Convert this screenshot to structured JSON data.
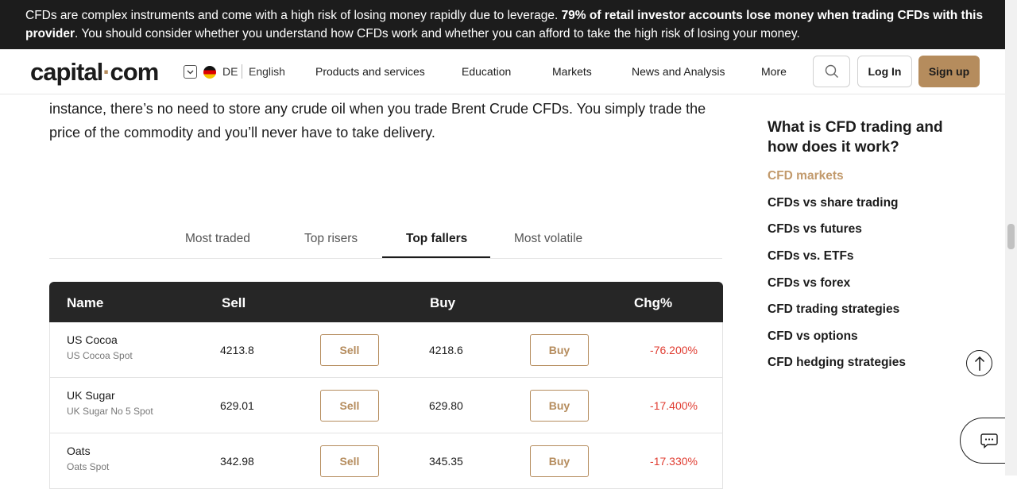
{
  "banner": {
    "text_before": "CFDs are complex instruments and come with a high risk of losing money rapidly due to leverage. ",
    "bold": "79% of retail investor accounts lose money when trading CFDs with this provider",
    "text_after": ". You should consider whether you understand how CFDs work and whether you can afford to take the high risk of losing your money."
  },
  "nav": {
    "logo_part1": "capital",
    "logo_dot": "·",
    "logo_part2": "com",
    "lang_code": "DE",
    "lang_name": "English",
    "items": [
      "Products and services",
      "Education",
      "Markets",
      "News and Analysis",
      "More"
    ],
    "login": "Log In",
    "signup": "Sign up"
  },
  "article": {
    "text": "instance, there’s no need to store any crude oil when you trade Brent Crude CFDs. You simply trade the price of the commodity and you’ll never have to take delivery."
  },
  "tabs": {
    "items": [
      "Most traded",
      "Top risers",
      "Top fallers",
      "Most volatile"
    ],
    "active": "Top fallers"
  },
  "table": {
    "headers": {
      "name": "Name",
      "sell": "Sell",
      "buy": "Buy",
      "chg": "Chg%"
    },
    "sell_button": "Sell",
    "buy_button": "Buy",
    "rows": [
      {
        "name": "US Cocoa",
        "sub": "US Cocoa Spot",
        "sell": "4213.8",
        "buy": "4218.6",
        "chg": "-76.200%"
      },
      {
        "name": "UK Sugar",
        "sub": "UK Sugar No 5 Spot",
        "sell": "629.01",
        "buy": "629.80",
        "chg": "-17.400%"
      },
      {
        "name": "Oats",
        "sub": "Oats Spot",
        "sell": "342.98",
        "buy": "345.35",
        "chg": "-17.330%"
      }
    ]
  },
  "toc": {
    "title": "What is CFD trading and how does it work?",
    "items": [
      "CFD markets",
      "CFDs vs share trading",
      "CFDs vs futures",
      "CFDs vs. ETFs",
      "CFDs vs forex",
      "CFD trading strategies",
      "CFD vs options",
      "CFD hedging strategies"
    ],
    "active": "CFD markets"
  },
  "colors": {
    "accent": "#b58c5d",
    "negative": "#e03c31",
    "header_dark": "#262626"
  }
}
